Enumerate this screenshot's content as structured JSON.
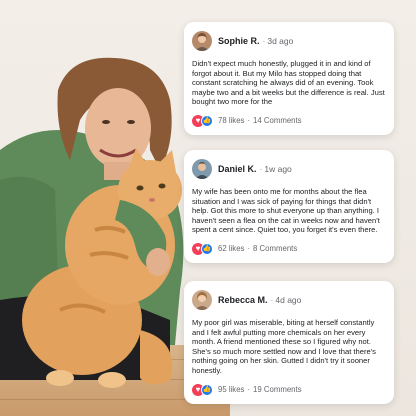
{
  "posts": [
    {
      "name": "Sophie R.",
      "separator": "·",
      "time": "3d ago",
      "text": "Didn't expect much honestly, plugged it in and kind of forgot about it. But my Milo has stopped doing that constant scratching he always did of an evening. Took maybe two and a bit weeks but the difference is real. Just bought two more for the",
      "likes": "78 likes",
      "dot": "·",
      "comments": "14 Comments",
      "avatar_icon": "person-avatar-icon"
    },
    {
      "name": "Daniel K.",
      "separator": "·",
      "time": "1w ago",
      "text": "My wife has been onto me for months about the flea situation and I was sick of paying for things that didn't help. Got this more to shut everyone up than anything. I haven't seen a flea on the cat in weeks now and haven't spent a cent since. Quiet too, you forget it's even there.",
      "likes": "62 likes",
      "dot": "·",
      "comments": "8 Comments",
      "avatar_icon": "person-avatar-icon"
    },
    {
      "name": "Rebecca M.",
      "separator": "·",
      "time": "4d ago",
      "text": "My poor girl was miserable, biting at herself constantly and I felt awful putting more chemicals on her every month. A friend mentioned these so I figured why not. She's so much more settled now and I love that there's nothing going on her skin. Gutted I didn't try it sooner honestly.",
      "likes": "95 likes",
      "dot": "·",
      "comments": "19 Comments",
      "avatar_icon": "person-avatar-icon"
    }
  ],
  "reaction_icons": [
    "heart-icon",
    "thumbs-up-icon"
  ],
  "colors": {
    "heart": "#f33e58",
    "like": "#1877f2",
    "card_bg": "#ffffff",
    "text": "#1c1e21",
    "muted": "#65676b"
  }
}
